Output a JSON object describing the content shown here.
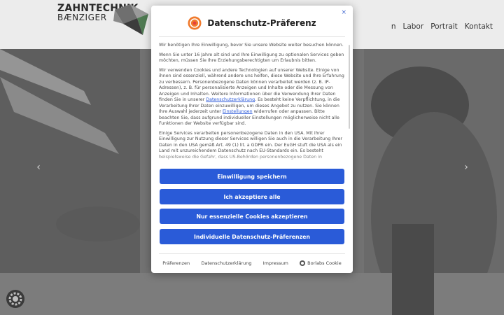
{
  "site": {
    "logo_line1": "ZAHNTECHNIK",
    "logo_line2": "BÆNZIGER",
    "nav": [
      "n",
      "Labor",
      "Portrait",
      "Kontakt"
    ]
  },
  "carousel": {
    "prev_glyph": "‹",
    "next_glyph": "›"
  },
  "dialog": {
    "close_label": "×",
    "title": "Datenschutz-Präferenz",
    "p1": "Wir benötigen Ihre Einwilligung, bevor Sie unsere Website weiter besuchen können.",
    "p2": "Wenn Sie unter 16 Jahre alt sind und Ihre Einwilligung zu optionalen Services geben möchten, müssen Sie Ihre Erziehungsberechtigten um Erlaubnis bitten.",
    "p3a": "Wir verwenden Cookies und andere Technologien auf unserer Website. Einige von ihnen sind essenziell, während andere uns helfen, diese Website und Ihre Erfahrung zu verbessern. Personenbezogene Daten können verarbeitet werden (z. B. IP-Adressen), z. B. für personalisierte Anzeigen und Inhalte oder die Messung von Anzeigen und Inhalten. Weitere Informationen über die Verwendung Ihrer Daten finden Sie in unserer ",
    "p3_link1": "Datenschutzerklärung",
    "p3b": ". Es besteht keine Verpflichtung, in die Verarbeitung Ihrer Daten einzuwilligen, um dieses Angebot zu nutzen. Sie können Ihre Auswahl jederzeit unter ",
    "p3_link2": "Einstellungen",
    "p3c": " widerrufen oder anpassen. Bitte beachten Sie, dass aufgrund individueller Einstellungen möglicherweise nicht alle Funktionen der Website verfügbar sind.",
    "p4": "Einige Services verarbeiten personenbezogene Daten in den USA. Mit ihrer Einwilligung zur Nutzung dieser Services willigen Sie auch in die Verarbeitung Ihrer Daten in den USA gemäß Art. 49 (1) lit. a GDPR ein. Der EuGH stuft die USA als ein Land mit unzureichendem Datenschutz nach EU-Standards ein. Es besteht beispielsweise die Gefahr, dass US-Behörden personenbezogene Daten in",
    "buttons": {
      "save": "Einwilligung speichern",
      "accept_all": "Ich akzeptiere alle",
      "essential_only": "Nur essenzielle Cookies akzeptieren",
      "individual": "Individuelle Datenschutz-Präferenzen"
    },
    "footer_links": {
      "preferences": "Präferenzen",
      "privacy_policy": "Datenschutzerklärung",
      "imprint": "Impressum",
      "borlabs": "Borlabs Cookie"
    }
  },
  "colors": {
    "primary_button": "#2a5bd8",
    "header_bg": "#ececec"
  }
}
